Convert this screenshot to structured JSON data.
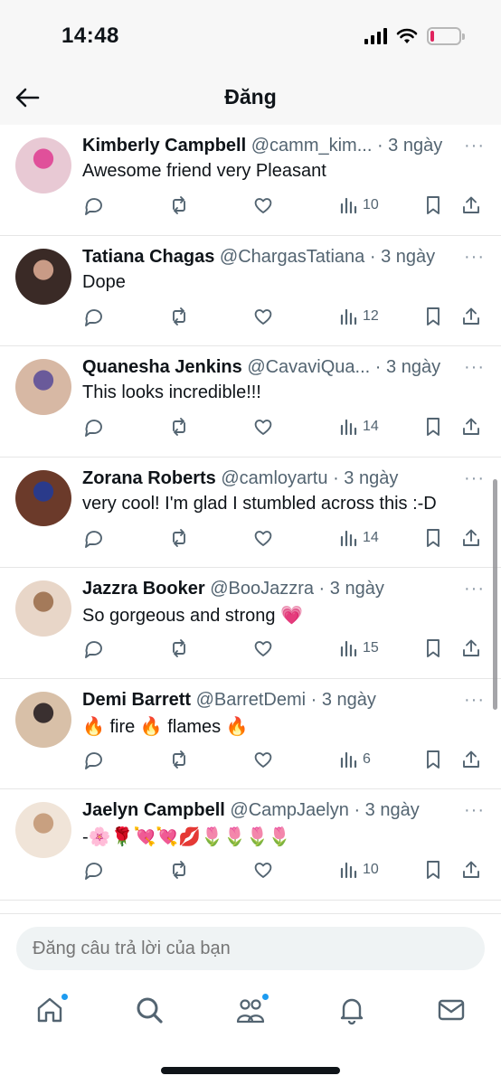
{
  "status": {
    "time": "14:48"
  },
  "header": {
    "title": "Đăng"
  },
  "tweets": [
    {
      "name": "Kimberly Campbell",
      "handle": "@camm_kim...",
      "time": "· 3 ngày",
      "text": "Awesome friend  very Pleasant",
      "views": "10",
      "avatar_colors": [
        "#e8c9d4",
        "#e0509a"
      ]
    },
    {
      "name": "Tatiana Chagas",
      "handle": "@ChargasTatiana",
      "time": "· 3 ngày",
      "text": "Dope",
      "views": "12",
      "avatar_colors": [
        "#3a2a26",
        "#c99b86"
      ]
    },
    {
      "name": "Quanesha Jenkins",
      "handle": "@CavaviQua...",
      "time": "· 3 ngày",
      "text": "This looks incredible!!!",
      "views": "14",
      "avatar_colors": [
        "#d7b8a4",
        "#6a5a9a"
      ]
    },
    {
      "name": "Zorana Roberts",
      "handle": "@camloyartu",
      "time": "· 3 ngày",
      "text": "very cool! I'm glad I stumbled across this :-D",
      "views": "14",
      "avatar_colors": [
        "#6b3a2a",
        "#2a3a8a"
      ]
    },
    {
      "name": "Jazzra Booker",
      "handle": "@BooJazzra",
      "time": "· 3 ngày",
      "text": "So gorgeous and strong 💗",
      "views": "15",
      "avatar_colors": [
        "#e8d6c8",
        "#a47a5a"
      ]
    },
    {
      "name": "Demi Barrett",
      "handle": "@BarretDemi",
      "time": "· 3 ngày",
      "text": "🔥 fire 🔥 flames 🔥",
      "views": "6",
      "avatar_colors": [
        "#d8c0a8",
        "#3a3030"
      ]
    },
    {
      "name": "Jaelyn Campbell",
      "handle": "@CampJaelyn",
      "time": "· 3 ngày",
      "text": "-🌸🌹💘💘💋🌷🌷🌷🌷",
      "views": "10",
      "avatar_colors": [
        "#f0e4d8",
        "#c8a080"
      ]
    }
  ],
  "reply": {
    "placeholder": "Đăng câu trả lời của bạn"
  },
  "nav": [
    "home-icon",
    "search-icon",
    "communities-icon",
    "notifications-icon",
    "messages-icon"
  ],
  "colors": {
    "accent": "#1d9bf0",
    "text": "#0f1419",
    "muted": "#536471"
  }
}
